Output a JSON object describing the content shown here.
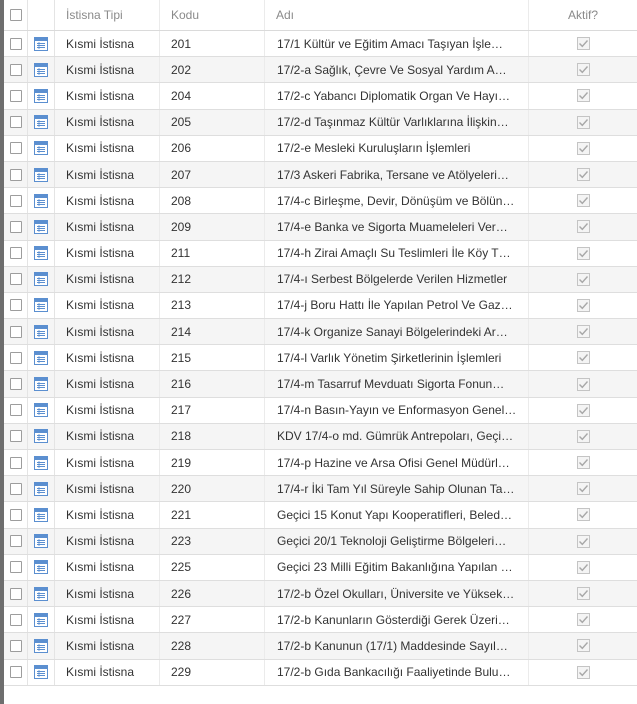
{
  "header": {
    "istisna_tipi": "İstisna Tipi",
    "kodu": "Kodu",
    "adi": "Adı",
    "aktif": "Aktif?"
  },
  "colors": {
    "icon_blue": "#5b8fd0",
    "check_gray": "#a8a8a8"
  },
  "rows": [
    {
      "tip": "Kısmi İstisna",
      "kod": "201",
      "adi": "17/1 Kültür ve Eğitim Amacı Taşıyan İşle…",
      "aktif": true
    },
    {
      "tip": "Kısmi İstisna",
      "kod": "202",
      "adi": "17/2-a Sağlık, Çevre Ve Sosyal Yardım A…",
      "aktif": true
    },
    {
      "tip": "Kısmi İstisna",
      "kod": "204",
      "adi": "17/2-c Yabancı Diplomatik Organ Ve Hayı…",
      "aktif": true
    },
    {
      "tip": "Kısmi İstisna",
      "kod": "205",
      "adi": "17/2-d Taşınmaz Kültür Varlıklarına İlişkin…",
      "aktif": true
    },
    {
      "tip": "Kısmi İstisna",
      "kod": "206",
      "adi": "17/2-e Mesleki Kuruluşların İşlemleri",
      "aktif": true
    },
    {
      "tip": "Kısmi İstisna",
      "kod": "207",
      "adi": "17/3 Askeri Fabrika, Tersane ve Atölyeleri…",
      "aktif": true
    },
    {
      "tip": "Kısmi İstisna",
      "kod": "208",
      "adi": "17/4-c Birleşme, Devir, Dönüşüm ve Bölün…",
      "aktif": true
    },
    {
      "tip": "Kısmi İstisna",
      "kod": "209",
      "adi": "17/4-e Banka ve Sigorta Muameleleri Ver…",
      "aktif": true
    },
    {
      "tip": "Kısmi İstisna",
      "kod": "211",
      "adi": "17/4-h Zirai Amaçlı Su Teslimleri İle Köy T…",
      "aktif": true
    },
    {
      "tip": "Kısmi İstisna",
      "kod": "212",
      "adi": "17/4-ı Serbest Bölgelerde Verilen Hizmetler",
      "aktif": true
    },
    {
      "tip": "Kısmi İstisna",
      "kod": "213",
      "adi": "17/4-j Boru Hattı İle Yapılan Petrol Ve Gaz…",
      "aktif": true
    },
    {
      "tip": "Kısmi İstisna",
      "kod": "214",
      "adi": "17/4-k Organize Sanayi Bölgelerindeki Ar…",
      "aktif": true
    },
    {
      "tip": "Kısmi İstisna",
      "kod": "215",
      "adi": "17/4-l Varlık Yönetim Şirketlerinin İşlemleri",
      "aktif": true
    },
    {
      "tip": "Kısmi İstisna",
      "kod": "216",
      "adi": "17/4-m Tasarruf Mevduatı Sigorta Fonun…",
      "aktif": true
    },
    {
      "tip": "Kısmi İstisna",
      "kod": "217",
      "adi": "17/4-n Basın-Yayın ve Enformasyon Genel…",
      "aktif": true
    },
    {
      "tip": "Kısmi İstisna",
      "kod": "218",
      "adi": "KDV 17/4-o md. Gümrük Antrepoları, Geçi…",
      "aktif": true
    },
    {
      "tip": "Kısmi İstisna",
      "kod": "219",
      "adi": "17/4-p Hazine ve Arsa Ofisi Genel Müdürl…",
      "aktif": true
    },
    {
      "tip": "Kısmi İstisna",
      "kod": "220",
      "adi": "17/4-r İki Tam Yıl Süreyle Sahip Olunan Ta…",
      "aktif": true
    },
    {
      "tip": "Kısmi İstisna",
      "kod": "221",
      "adi": "Geçici 15 Konut Yapı Kooperatifleri, Beled…",
      "aktif": true
    },
    {
      "tip": "Kısmi İstisna",
      "kod": "223",
      "adi": "Geçici 20/1 Teknoloji Geliştirme Bölgeleri…",
      "aktif": true
    },
    {
      "tip": "Kısmi İstisna",
      "kod": "225",
      "adi": "Geçici 23 Milli Eğitim Bakanlığına Yapılan …",
      "aktif": true
    },
    {
      "tip": "Kısmi İstisna",
      "kod": "226",
      "adi": "17/2-b Özel Okulları, Üniversite ve Yüksek…",
      "aktif": true
    },
    {
      "tip": "Kısmi İstisna",
      "kod": "227",
      "adi": "17/2-b Kanunların Gösterdiği Gerek Üzeri…",
      "aktif": true
    },
    {
      "tip": "Kısmi İstisna",
      "kod": "228",
      "adi": "17/2-b Kanunun (17/1) Maddesinde Sayıl…",
      "aktif": true
    },
    {
      "tip": "Kısmi İstisna",
      "kod": "229",
      "adi": "17/2-b Gıda Bankacılığı Faaliyetinde Bulu…",
      "aktif": true
    }
  ]
}
